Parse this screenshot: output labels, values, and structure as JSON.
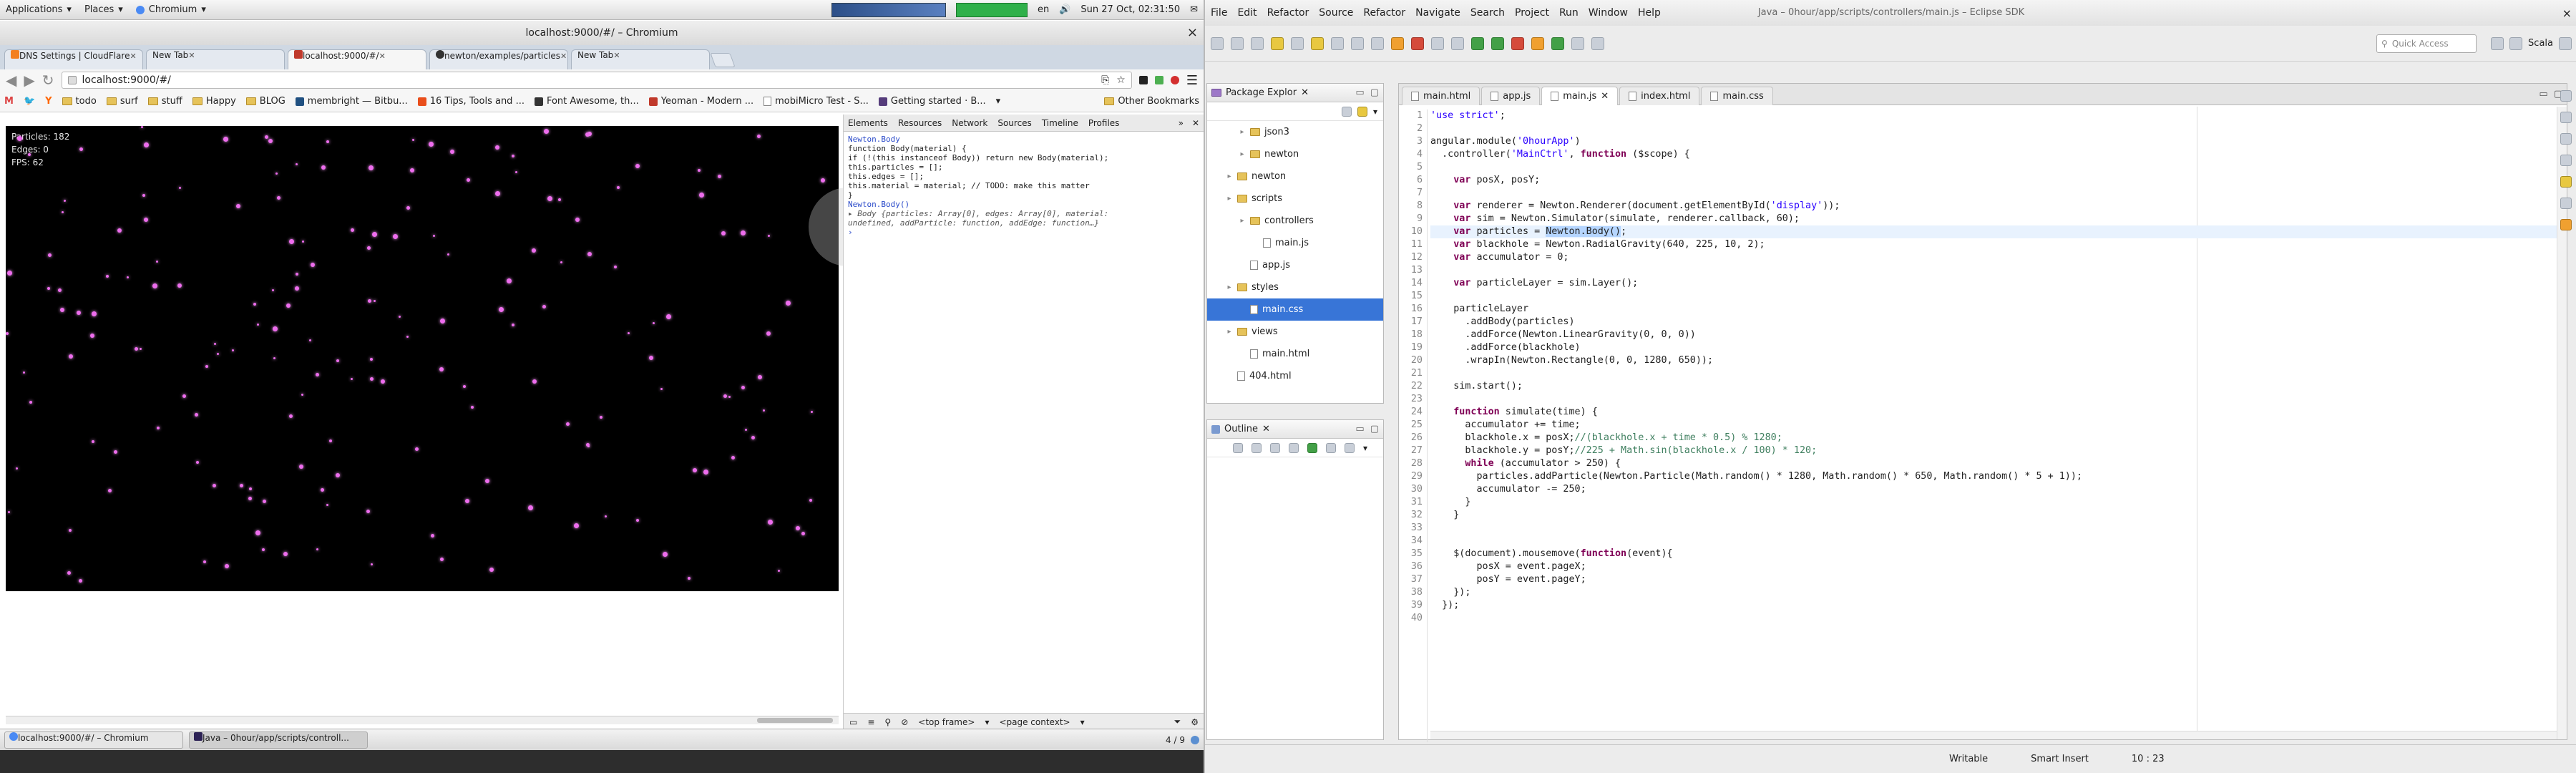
{
  "system_panel": {
    "menus": [
      "Applications",
      "Places",
      "Chromium"
    ],
    "locale": "en",
    "datetime": "Sun 27 Oct, 02:31:50"
  },
  "browser": {
    "window_title": "localhost:9000/#/ – Chromium",
    "tabs": [
      {
        "label": "DNS Settings | CloudFlare",
        "active": false
      },
      {
        "label": "New Tab",
        "active": false
      },
      {
        "label": "localhost:9000/#/",
        "active": true
      },
      {
        "label": "newton/examples/particles",
        "active": false
      },
      {
        "label": "New Tab",
        "active": false
      }
    ],
    "url": "localhost:9000/#/",
    "bookmarks": [
      "todo",
      "surf",
      "stuff",
      "Happy",
      "BLOG",
      "membright — Bitbu...",
      "16 Tips, Tools and ...",
      "Font Awesome, th...",
      "Yeoman - Modern ...",
      "mobiMicro Test - S...",
      "Getting started · B..."
    ],
    "other_bookmarks": "Other Bookmarks",
    "hud": {
      "particles": "Particles: 182",
      "edges": "Edges: 0",
      "fps": "FPS: 62"
    },
    "devtools": {
      "tabs": [
        "Elements",
        "Resources",
        "Network",
        "Sources",
        "Timeline",
        "Profiles"
      ],
      "console_lines": [
        "Newton.Body",
        "function Body(material) {",
        "  if (!(this instanceof Body)) return new Body(material);",
        "  this.particles = [];",
        "  this.edges = [];",
        "  this.material = material; // TODO: make this matter",
        "}",
        "Newton.Body()",
        "▸ Body {particles: Array[0], edges: Array[0], material:",
        "  undefined, addParticle: function, addEdge: function…}"
      ],
      "frame_select": "<top frame>",
      "context_select": "<page context>"
    }
  },
  "taskbar": {
    "items": [
      "localhost:9000/#/ – Chromium",
      "Java – 0hour/app/scripts/controll..."
    ],
    "pager": "4 / 9"
  },
  "eclipse": {
    "window_title": "Java – 0hour/app/scripts/controllers/main.js – Eclipse SDK",
    "menus": [
      "File",
      "Edit",
      "Refactor",
      "Source",
      "Refactor",
      "Navigate",
      "Search",
      "Project",
      "Run",
      "Window",
      "Help"
    ],
    "quick_access": "Quick Access",
    "perspective": "Scala",
    "package_explorer": {
      "title": "Package Explor",
      "items": [
        {
          "label": "json3",
          "type": "folder",
          "indent": 2,
          "selected": false
        },
        {
          "label": "newton",
          "type": "folder",
          "indent": 2,
          "selected": false
        },
        {
          "label": "newton",
          "type": "folder",
          "indent": 1,
          "selected": false
        },
        {
          "label": "scripts",
          "type": "folder",
          "indent": 1,
          "selected": false
        },
        {
          "label": "controllers",
          "type": "folder",
          "indent": 2,
          "selected": false
        },
        {
          "label": "main.js",
          "type": "file",
          "indent": 3,
          "selected": false
        },
        {
          "label": "app.js",
          "type": "file",
          "indent": 2,
          "selected": false
        },
        {
          "label": "styles",
          "type": "folder",
          "indent": 1,
          "selected": false
        },
        {
          "label": "main.css",
          "type": "file",
          "indent": 2,
          "selected": true
        },
        {
          "label": "views",
          "type": "folder",
          "indent": 1,
          "selected": false
        },
        {
          "label": "main.html",
          "type": "file",
          "indent": 2,
          "selected": false
        },
        {
          "label": "404.html",
          "type": "file",
          "indent": 1,
          "selected": false
        }
      ]
    },
    "outline": {
      "title": "Outline"
    },
    "editor_tabs": [
      {
        "label": "main.html",
        "active": false
      },
      {
        "label": "app.js",
        "active": false
      },
      {
        "label": "main.js",
        "active": true
      },
      {
        "label": "index.html",
        "active": false
      },
      {
        "label": "main.css",
        "active": false
      }
    ],
    "code_lines": [
      "'use strict';",
      "",
      "angular.module('0hourApp')",
      "  .controller('MainCtrl', function ($scope) {",
      "",
      "    var posX, posY;",
      "",
      "    var renderer = Newton.Renderer(document.getElementById('display'));",
      "    var sim = Newton.Simulator(simulate, renderer.callback, 60);",
      "    var particles = Newton.Body();",
      "    var blackhole = Newton.RadialGravity(640, 225, 10, 2);",
      "    var accumulator = 0;",
      "",
      "    var particleLayer = sim.Layer();",
      "",
      "    particleLayer",
      "      .addBody(particles)",
      "      .addForce(Newton.LinearGravity(0, 0, 0))",
      "      .addForce(blackhole)",
      "      .wrapIn(Newton.Rectangle(0, 0, 1280, 650));",
      "",
      "    sim.start();",
      "",
      "    function simulate(time) {",
      "      accumulator += time;",
      "      blackhole.x = posX;//(blackhole.x + time * 0.5) % 1280;",
      "      blackhole.y = posY;//225 + Math.sin(blackhole.x / 100) * 120;",
      "      while (accumulator > 250) {",
      "        particles.addParticle(Newton.Particle(Math.random() * 1280, Math.random() * 650, Math.random() * 5 + 1));",
      "        accumulator -= 250;",
      "      }",
      "    }",
      "",
      "",
      "    $(document).mousemove(function(event){",
      "        posX = event.pageX;",
      "        posY = event.pageY;",
      "    });",
      "  });",
      ""
    ],
    "current_line": 10,
    "status": {
      "writable": "Writable",
      "insert_mode": "Smart Insert",
      "position": "10 : 23"
    }
  }
}
